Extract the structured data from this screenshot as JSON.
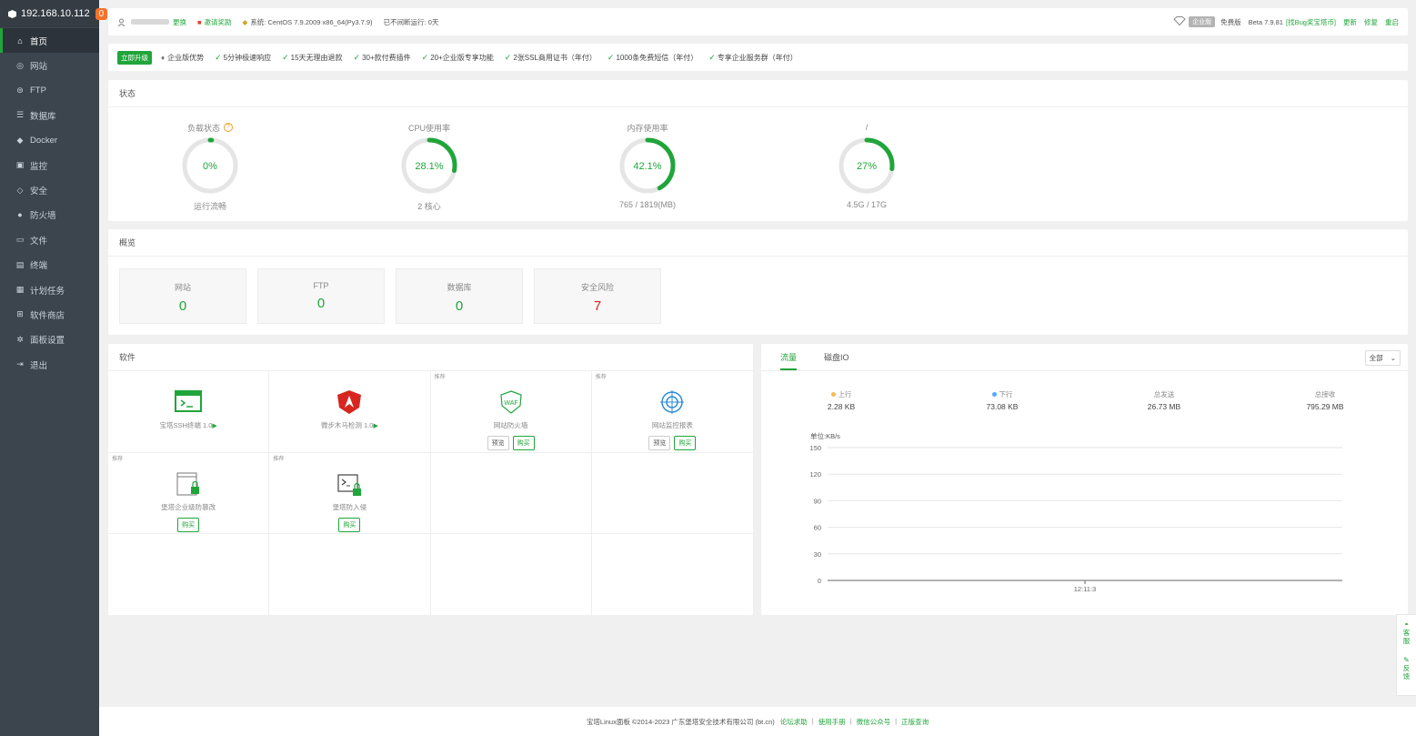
{
  "sidebar": {
    "host": "192.168.10.112",
    "badge": "0",
    "items": [
      {
        "label": "首页",
        "icon": "home-icon",
        "glyph": "⌂"
      },
      {
        "label": "网站",
        "icon": "globe-icon",
        "glyph": "◎"
      },
      {
        "label": "FTP",
        "icon": "ftp-icon",
        "glyph": "⊜"
      },
      {
        "label": "数据库",
        "icon": "database-icon",
        "glyph": "☰"
      },
      {
        "label": "Docker",
        "icon": "docker-icon",
        "glyph": "◆"
      },
      {
        "label": "监控",
        "icon": "monitor-icon",
        "glyph": "▣"
      },
      {
        "label": "安全",
        "icon": "shield-icon",
        "glyph": "◇"
      },
      {
        "label": "防火墙",
        "icon": "firewall-icon",
        "glyph": "●"
      },
      {
        "label": "文件",
        "icon": "folder-icon",
        "glyph": "▭"
      },
      {
        "label": "终端",
        "icon": "terminal-icon",
        "glyph": "▤"
      },
      {
        "label": "计划任务",
        "icon": "calendar-icon",
        "glyph": "▦"
      },
      {
        "label": "软件商店",
        "icon": "apps-icon",
        "glyph": "⊞"
      },
      {
        "label": "面板设置",
        "icon": "gear-icon",
        "glyph": "✲"
      },
      {
        "label": "退出",
        "icon": "logout-icon",
        "glyph": "⇥"
      }
    ]
  },
  "topbar": {
    "switch": "更换",
    "invite": "邀请奖励",
    "system": "系统:  CentOS 7.9.2009 x86_64(Py3.7.9)",
    "uptime": "已不间断运行: 0天",
    "enterprise": "企业版",
    "free": "免费版",
    "version": "Beta 7.9.81",
    "bug_bounty": "[找Bug奖宝塔币]",
    "update": "更新",
    "repair": "修复",
    "restart": "重启"
  },
  "upgrade": {
    "button": "立即升级",
    "title": "企业版优势",
    "features": [
      "5分钟极速响应",
      "15天无理由退款",
      "30+款付费插件",
      "20+企业版专享功能",
      "2张SSL商用证书（年付）",
      "1000条免费短信（年付）",
      "专享企业服务群（年付）"
    ]
  },
  "status": {
    "title": "状态",
    "gauges": [
      {
        "title": "负载状态",
        "value": "0%",
        "percent": 1,
        "sub": "运行流畅",
        "help": "?"
      },
      {
        "title": "CPU使用率",
        "value": "28.1%",
        "percent": 28.1,
        "sub": "2 核心"
      },
      {
        "title": "内存使用率",
        "value": "42.1%",
        "percent": 42.1,
        "sub": "765 / 1819(MB)"
      },
      {
        "title": "/",
        "value": "27%",
        "percent": 27,
        "sub": "4.5G / 17G"
      }
    ]
  },
  "overview": {
    "title": "概览",
    "boxes": [
      {
        "label": "网站",
        "value": "0"
      },
      {
        "label": "FTP",
        "value": "0"
      },
      {
        "label": "数据库",
        "value": "0"
      },
      {
        "label": "安全风险",
        "value": "7"
      }
    ]
  },
  "software": {
    "title": "软件",
    "items": [
      {
        "name": "宝塔SSH终端 1.0",
        "icon": "ssh-terminal-icon",
        "tag": "",
        "play": "▶"
      },
      {
        "name": "微步木马检测 1.0",
        "icon": "threatbook-shield-icon",
        "tag": "",
        "play": "▶"
      },
      {
        "name": "网站防火墙",
        "icon": "waf-icon",
        "tag": "推荐",
        "preview": "预览",
        "buy": "购买"
      },
      {
        "name": "网站监控报表",
        "icon": "monitor-report-icon",
        "tag": "推荐",
        "preview": "预览",
        "buy": "购买"
      },
      {
        "name": "堡塔企业级防篡改",
        "icon": "tamper-proof-icon",
        "tag": "推荐",
        "buy": "购买"
      },
      {
        "name": "堡塔防入侵",
        "icon": "intrusion-icon",
        "tag": "推荐",
        "buy": "购买"
      }
    ]
  },
  "traffic": {
    "tabs": [
      "流量",
      "磁盘IO"
    ],
    "select": "全部",
    "stats": [
      {
        "label": "上行",
        "value": "2.28 KB",
        "color": "#f7b851"
      },
      {
        "label": "下行",
        "value": "73.08 KB",
        "color": "#52a9ff"
      },
      {
        "label": "总发送",
        "value": "26.73 MB"
      },
      {
        "label": "总接收",
        "value": "795.29 MB"
      }
    ]
  },
  "chart_data": {
    "type": "line",
    "ylabel": "单位:KB/s",
    "ylim": [
      0,
      150
    ],
    "yticks": [
      "150",
      "120",
      "90",
      "60",
      "30",
      "0"
    ],
    "x": [
      "12:11:3"
    ],
    "series": []
  },
  "footer": {
    "copyright": "宝塔Linux面板 ©2014-2023 广东堡塔安全技术有限公司 (bt.cn)",
    "links": [
      "论坛求助",
      "使用手册",
      "微信公众号",
      "正版查询"
    ]
  },
  "float_bar": {
    "service": "客服",
    "feedback": "反馈"
  },
  "colors": {
    "accent": "#20a53a",
    "sidebar": "#3c444d",
    "danger": "#e02020"
  }
}
